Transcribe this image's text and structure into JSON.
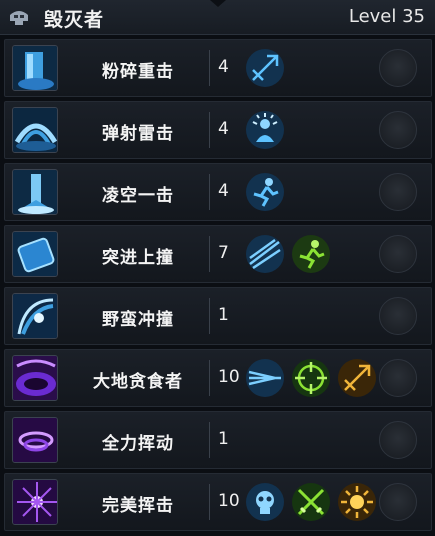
{
  "header": {
    "title": "毁灭者",
    "level": "Level 35"
  },
  "skills": [
    {
      "name": "粉碎重击",
      "count": "4",
      "icon": "pillar-impact-icon",
      "mods": [
        "crossbow-arrow-icon"
      ]
    },
    {
      "name": "弹射雷击",
      "count": "4",
      "icon": "shockwave-icon",
      "mods": [
        "radiant-figure-icon"
      ]
    },
    {
      "name": "凌空一击",
      "count": "4",
      "icon": "leap-strike-icon",
      "mods": [
        "running-figure-icon"
      ]
    },
    {
      "name": "突进上撞",
      "count": "7",
      "icon": "dash-shield-icon",
      "mods": [
        "ice-shards-icon",
        "green-runner-icon"
      ]
    },
    {
      "name": "野蛮冲撞",
      "count": "1",
      "icon": "vortex-charge-icon",
      "mods": []
    },
    {
      "name": "大地贪食者",
      "count": "10",
      "icon": "purple-crater-icon",
      "mods": [
        "speed-streak-icon",
        "green-target-icon",
        "gold-crossbow-icon"
      ]
    },
    {
      "name": "全力挥动",
      "count": "1",
      "icon": "purple-swirl-icon",
      "mods": []
    },
    {
      "name": "完美挥击",
      "count": "10",
      "icon": "purple-sunburst-icon",
      "mods": [
        "blue-skull-icon",
        "green-swords-icon",
        "gold-sun-icon"
      ]
    }
  ]
}
